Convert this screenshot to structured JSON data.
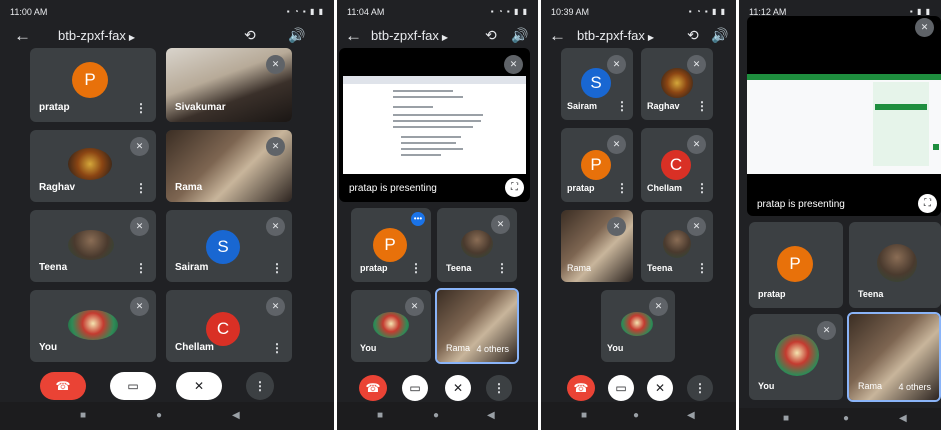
{
  "meeting_title": "btb-zpxf-fax",
  "colors": {
    "avatar_p": "#e8710a",
    "avatar_s": "#1967d2",
    "avatar_c": "#d93025",
    "end_call": "#ea4335",
    "tile": "#3c4043"
  },
  "screen1": {
    "time": "11:00 AM",
    "status_icons": "▪ ◔ ▪ ▮ ▮",
    "tiles": [
      {
        "name": "pratap",
        "initial": "P"
      },
      {
        "name": "Sivakumar"
      },
      {
        "name": "Raghav"
      },
      {
        "name": "Rama"
      },
      {
        "name": "Teena"
      },
      {
        "name": "Sairam",
        "initial": "S"
      },
      {
        "name": "You"
      },
      {
        "name": "Chellam",
        "initial": "C"
      }
    ]
  },
  "screen2": {
    "time": "11:04 AM",
    "status_icons": "▪ ◔ ▪ ▮ ▮",
    "presenting": "pratap is presenting",
    "tiles": [
      {
        "name": "pratap",
        "initial": "P"
      },
      {
        "name": "Teena"
      },
      {
        "name": "You"
      },
      {
        "name": "Rama"
      }
    ],
    "others": "4 others"
  },
  "screen3": {
    "time": "10:39 AM",
    "status_icons": "▪ ◔ ▪ ▮ ▮",
    "tiles": [
      {
        "name": "Sairam",
        "initial": "S"
      },
      {
        "name": "Raghav"
      },
      {
        "name": "pratap",
        "initial": "P"
      },
      {
        "name": "Chellam",
        "initial": "C"
      },
      {
        "name": "Rama"
      },
      {
        "name": "Teena"
      },
      {
        "name": "You"
      }
    ]
  },
  "screen4": {
    "time": "11:12 AM",
    "status_icons": "▪ ▮ ▮",
    "presenting": "pratap is presenting",
    "tiles": [
      {
        "name": "pratap",
        "initial": "P"
      },
      {
        "name": "Teena"
      },
      {
        "name": "You"
      },
      {
        "name": "Rama"
      }
    ],
    "others": "4 others"
  },
  "icons": {
    "back": "arrow-left-icon",
    "switch_camera": "switch-camera-icon",
    "speaker": "speaker-icon",
    "mic_off": "mic-off-icon",
    "cam_off": "camera-off-icon",
    "end_call": "end-call-icon",
    "more": "more-vert-icon"
  }
}
